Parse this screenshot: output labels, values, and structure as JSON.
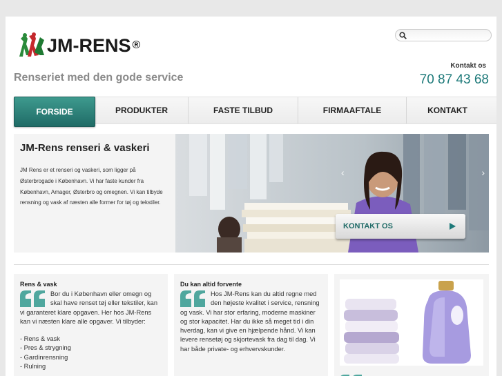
{
  "header": {
    "logo_text": "JM-RENS",
    "logo_reg": "®",
    "tagline": "Renseriet med den gode service",
    "search_placeholder": "",
    "contact_label": "Kontakt os",
    "contact_phone": "70 87 43 68"
  },
  "nav": {
    "items": [
      {
        "label": "FORSIDE",
        "active": true
      },
      {
        "label": "PRODUKTER"
      },
      {
        "label": "FASTE TILBUD"
      },
      {
        "label": "FIRMAAFTALE"
      },
      {
        "label": "KONTAKT"
      }
    ]
  },
  "hero": {
    "title": "JM-Rens renseri & vaskeri",
    "body": "JM Rens er et renseri og vaskeri, som ligger på Østerbrogade i København. Vi har faste kunder fra København, Amager, Østerbro og omegnen. Vi kan tilbyde rensning og vask af næsten alle former for tøj og tekstiler.",
    "button_label": "KONTAKT OS",
    "arrow_left": "‹",
    "arrow_right": "›"
  },
  "columns": [
    {
      "title": "Rens & vask",
      "body": "Bor du i København eller omegn og skal have renset tøj eller tekstiler, kan vi garanteret klare opgaven. Her hos JM-Rens kan vi næsten klare alle opgaver. Vi tilbyder:",
      "list": [
        "- Rens & vask",
        "- Pres & strygning",
        "- Gardinrensning",
        "- Rulning"
      ]
    },
    {
      "title": "Du kan altid forvente",
      "body": "Hos JM-Rens kan du altid regne med den højeste kvalitet i service, rensning og vask. Vi har stor erfaring, moderne maskiner og stor kapacitet. Har du ikke så meget tid i din hverdag, kan vi give en hjælpende hånd. Vi kan levere rensetøj og skjortevask fra dag til dag. Vi har både private- og erhvervskunder."
    }
  ],
  "colors": {
    "accent": "#1e7a7a",
    "nav_active": "#2f8580",
    "tagline": "#8a8a8a"
  }
}
